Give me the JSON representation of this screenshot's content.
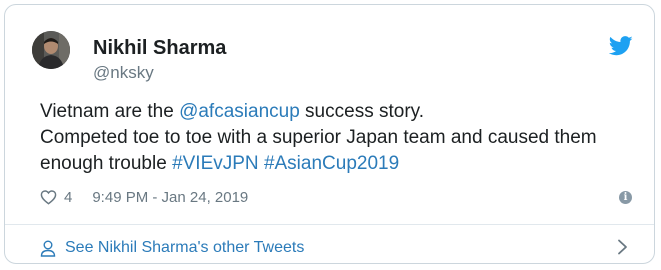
{
  "tweet": {
    "author": {
      "name": "Nikhil Sharma",
      "handle": "@nksky"
    },
    "text": {
      "line1_before": "Vietnam are the ",
      "mention": "@afcasiancup",
      "line1_after": " success story.",
      "line2": "Competed toe to toe with a superior Japan team and caused them",
      "line3_before": "enough trouble ",
      "hashtag1": "#VIEvJPN",
      "hashtag2": "#AsianCup2019"
    },
    "likes": "4",
    "timestamp": "9:49 PM - Jan 24, 2019",
    "info_glyph": "i",
    "footer_link": "See Nikhil Sharma's other Tweets"
  },
  "colors": {
    "link": "#2b7bb9",
    "text": "#1c2022",
    "secondary": "#697882",
    "border": "#ccd6dd",
    "twitter_blue": "#1da1f2"
  },
  "icons": {
    "brand": "twitter-bird-icon",
    "like": "heart-icon",
    "info": "info-icon",
    "footer": "person-icon",
    "chevron": "chevron-right-icon"
  }
}
